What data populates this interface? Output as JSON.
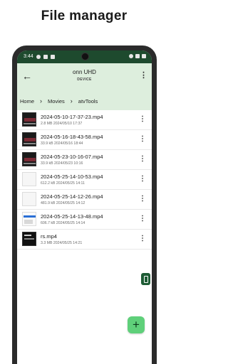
{
  "promo": {
    "title": "File manager"
  },
  "status_bar": {
    "time": "3:44"
  },
  "app_bar": {
    "title": "onn UHD",
    "subtitle": "DEVICE",
    "back_icon": "arrow-left-icon",
    "menu_icon": "more-vert-icon"
  },
  "breadcrumb": [
    "Home",
    "Movies",
    "atvTools"
  ],
  "files": [
    {
      "name": "2024-05-10-17-37-23.mp4",
      "meta": "2.8 MB  2024/05/10 17:37",
      "thumb": "dark"
    },
    {
      "name": "2024-05-16-18-43-58.mp4",
      "meta": "33.9 kB  2024/05/16 18:44",
      "thumb": "dark"
    },
    {
      "name": "2024-05-23-10-16-07.mp4",
      "meta": "33.9 kB  2024/05/23 10:16",
      "thumb": "dark"
    },
    {
      "name": "2024-05-25-14-10-53.mp4",
      "meta": "612.2 kB  2024/05/25 14:11",
      "thumb": "blank"
    },
    {
      "name": "2024-05-25-14-12-26.mp4",
      "meta": "481.9 kB  2024/05/25 14:12",
      "thumb": "blank"
    },
    {
      "name": "2024-05-25-14-13-48.mp4",
      "meta": "606.7 kB  2024/05/25 14:14",
      "thumb": "shot"
    },
    {
      "name": "rs.mp4",
      "meta": "3.3 MB  2024/05/25 14:21",
      "thumb": "dark2"
    }
  ],
  "row_menu_icon": "more-vert-icon",
  "side_button_icon": "remote-icon",
  "fab": {
    "label": "+",
    "icon": "plus-icon"
  },
  "colors": {
    "accent": "#1e4a2e",
    "app_bar_bg": "#ddeedd",
    "fab_bg": "#5fd07a"
  }
}
